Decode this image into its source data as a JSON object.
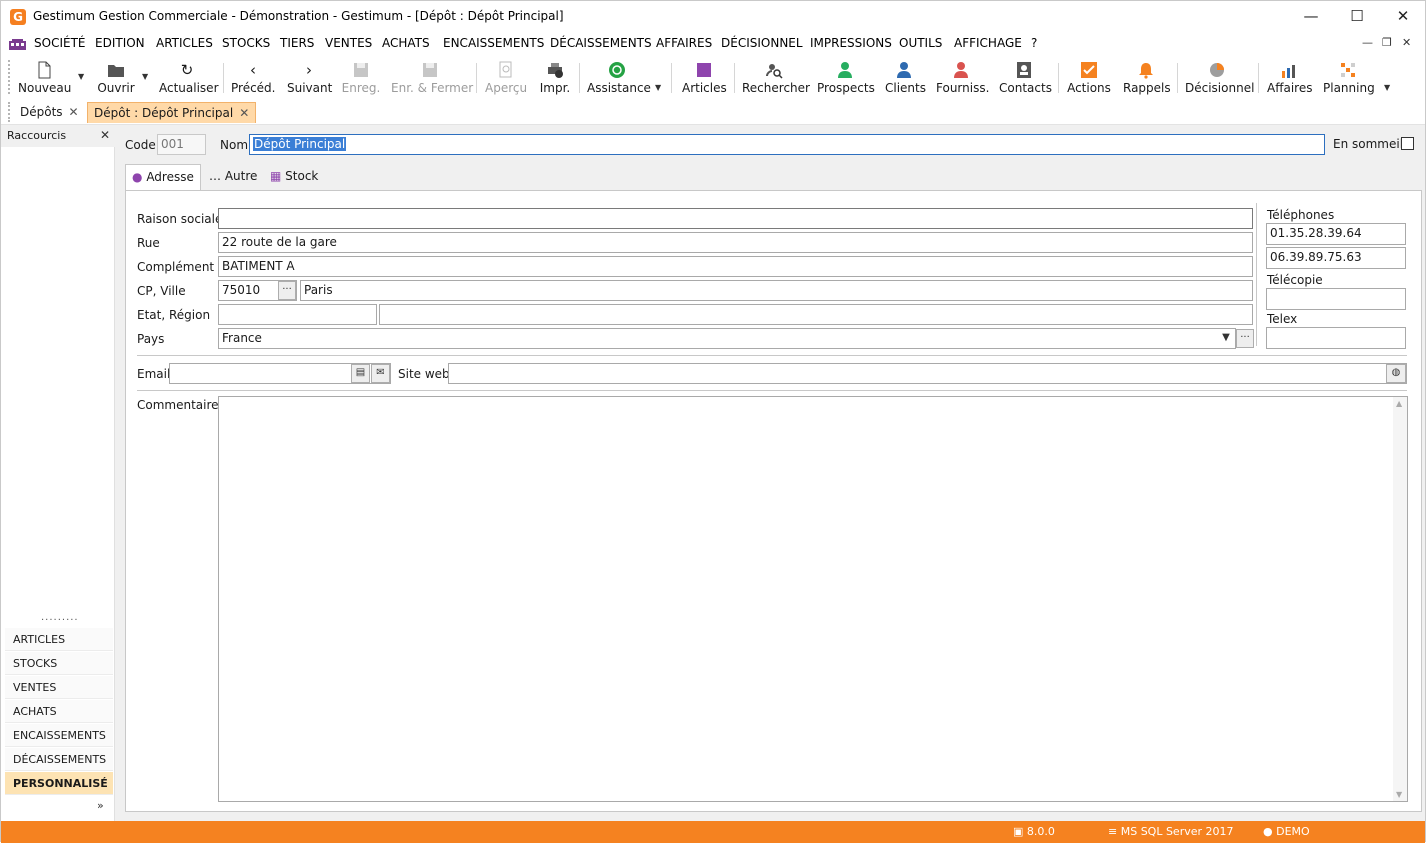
{
  "window": {
    "title": "Gestimum Gestion Commerciale - Démonstration - Gestimum - [Dépôt : Dépôt Principal]",
    "minimize": "—",
    "maximize": "☐",
    "close": "✕"
  },
  "menu": {
    "items": [
      "SOCIÉTÉ",
      "EDITION",
      "ARTICLES",
      "STOCKS",
      "TIERS",
      "VENTES",
      "ACHATS",
      "ENCAISSEMENTS",
      "DÉCAISSEMENTS",
      "AFFAIRES",
      "DÉCISIONNEL",
      "IMPRESSIONS",
      "OUTILS",
      "AFFICHAGE",
      "?"
    ],
    "mdi_minimize": "—",
    "mdi_restore": "❐",
    "mdi_close": "✕"
  },
  "toolbar": {
    "nouveau": "Nouveau",
    "ouvrir": "Ouvrir",
    "actualiser": "Actualiser",
    "preced": "Précéd.",
    "suivant": "Suivant",
    "enreg": "Enreg.",
    "enr_fermer": "Enr. & Fermer",
    "apercu": "Aperçu",
    "impr": "Impr.",
    "assistance": "Assistance",
    "articles": "Articles",
    "rechercher": "Rechercher",
    "prospects": "Prospects",
    "clients": "Clients",
    "fourniss": "Fourniss.",
    "contacts": "Contacts",
    "actions": "Actions",
    "rappels": "Rappels",
    "decisionnel": "Décisionnel",
    "affaires": "Affaires",
    "planning": "Planning"
  },
  "doc_tabs": [
    {
      "label": "Dépôts",
      "close": "✕"
    },
    {
      "label": "Dépôt : Dépôt Principal",
      "close": "✕"
    }
  ],
  "left_panel": {
    "title": "Raccourcis",
    "close": "✕",
    "dots": "·········",
    "items": [
      "ARTICLES",
      "STOCKS",
      "VENTES",
      "ACHATS",
      "ENCAISSEMENTS",
      "DÉCAISSEMENTS",
      "PERSONNALISÉ"
    ],
    "more": "»"
  },
  "form": {
    "code_label": "Code",
    "code_value": "001",
    "nom_label": "Nom",
    "nom_value": "Dépôt Principal",
    "sommeil_label": "En sommeil",
    "tabs": [
      "Adresse",
      "Autre",
      "Stock"
    ],
    "raison_sociale_label": "Raison sociale",
    "raison_sociale_value": "",
    "rue_label": "Rue",
    "rue_value": "22 route de la gare",
    "complement_label": "Complément",
    "complement_value": "BATIMENT A",
    "cp_ville_label": "CP, Ville",
    "cp_value": "75010",
    "ville_value": "Paris",
    "etat_region_label": "Etat, Région",
    "etat_value": "",
    "region_value": "",
    "pays_label": "Pays",
    "pays_value": "France",
    "telephones_label": "Téléphones",
    "tel1": "01.35.28.39.64",
    "tel2": "06.39.89.75.63",
    "telecopie_label": "Télécopie",
    "telecopie_value": "",
    "telex_label": "Telex",
    "telex_value": "",
    "email_label": "Email",
    "email_value": "",
    "site_web_label": "Site web",
    "site_web_value": "",
    "commentaires_label": "Commentaires"
  },
  "status_bar": {
    "version": "8.0.0",
    "database": "MS SQL Server 2017",
    "user": "DEMO"
  },
  "colors": {
    "accent": "#f58220",
    "active_tab": "#ffd9a8",
    "selection": "#3b7fd6"
  }
}
